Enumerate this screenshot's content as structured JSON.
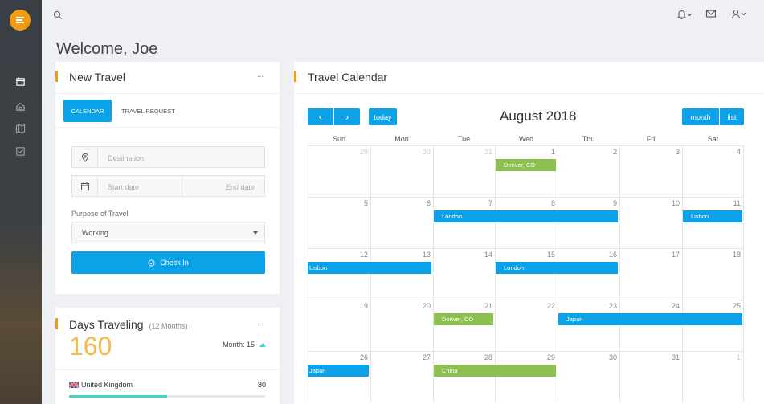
{
  "header": {
    "welcome": "Welcome, Joe"
  },
  "new_travel": {
    "title": "New Travel",
    "more": "...",
    "tabs": [
      {
        "label": "CALENDAR",
        "active": true
      },
      {
        "label": "TRAVEL REQUEST",
        "active": false
      }
    ],
    "destination_placeholder": "Destination",
    "start_date_placeholder": "Start date",
    "end_date_placeholder": "End date",
    "purpose_label": "Purpose of Travel",
    "purpose_value": "Working",
    "check_in_label": "Check In"
  },
  "days_traveling": {
    "title": "Days Traveling",
    "subtitle": "(12 Months)",
    "more": "...",
    "total": "160",
    "month_label": "Month: 15",
    "countries": [
      {
        "name": "United Kingdom",
        "value": "80",
        "progress": 0.5
      }
    ]
  },
  "calendar": {
    "title": "Travel Calendar",
    "month_title": "August 2018",
    "prev": "‹",
    "next": "›",
    "today": "today",
    "view_month": "month",
    "view_list": "list",
    "weekdays": [
      "Sun",
      "Mon",
      "Tue",
      "Wed",
      "Thu",
      "Fri",
      "Sat"
    ],
    "weeks": [
      [
        "29",
        "30",
        "31",
        "1",
        "2",
        "3",
        "4"
      ],
      [
        "5",
        "6",
        "7",
        "8",
        "9",
        "10",
        "11"
      ],
      [
        "12",
        "13",
        "14",
        "15",
        "16",
        "17",
        "18"
      ],
      [
        "19",
        "20",
        "21",
        "22",
        "23",
        "24",
        "25"
      ],
      [
        "26",
        "27",
        "28",
        "29",
        "30",
        "31",
        "1"
      ]
    ],
    "events": [
      {
        "label": "Denver, CO",
        "color": "green"
      },
      {
        "label": "London",
        "color": "blue"
      },
      {
        "label": "Lisbon",
        "color": "blue"
      },
      {
        "label": "Lisbon",
        "color": "blue"
      },
      {
        "label": "London",
        "color": "blue"
      },
      {
        "label": "Denver, CO",
        "color": "green"
      },
      {
        "label": "Japan",
        "color": "blue"
      },
      {
        "label": "Japan",
        "color": "blue"
      },
      {
        "label": "China",
        "color": "green"
      }
    ]
  },
  "colors": {
    "accent": "#f39c12",
    "primary": "#0ba2e8",
    "green": "#8cc152",
    "teal": "#3dd5c6"
  }
}
